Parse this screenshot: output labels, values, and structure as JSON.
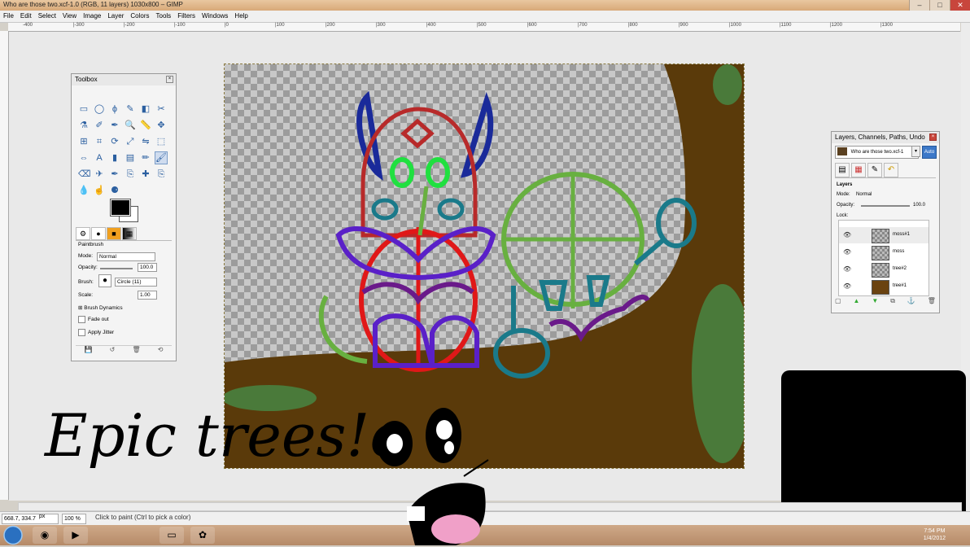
{
  "window": {
    "title": "Who are those two.xcf-1.0 (RGB, 11 layers) 1030x800 – GIMP",
    "controls": [
      "minimize",
      "maximize",
      "close"
    ]
  },
  "menu": [
    "File",
    "Edit",
    "Select",
    "View",
    "Image",
    "Layer",
    "Colors",
    "Tools",
    "Filters",
    "Windows",
    "Help"
  ],
  "ruler": {
    "ticks": [
      "-400",
      "|-300",
      "|-200",
      "|-100",
      "|0",
      "|100",
      "|200",
      "|300",
      "|400",
      "|500",
      "|600",
      "|700",
      "|800",
      "|900",
      "|1000",
      "|1100",
      "|1200",
      "|1300"
    ]
  },
  "toolbox": {
    "title": "Toolbox",
    "tools": [
      "rect-select-icon",
      "ellipse-select-icon",
      "free-select-icon",
      "fuzzy-select-icon",
      "color-select-icon",
      "scissors-icon",
      "foreground-select-icon",
      "paths-icon",
      "color-picker-icon",
      "zoom-icon",
      "measure-icon",
      "move-icon",
      "align-icon",
      "crop-icon",
      "rotate-icon",
      "scale-icon",
      "shear-icon",
      "perspective-icon",
      "flip-icon",
      "text-icon",
      "bucket-fill-icon",
      "blend-icon",
      "pencil-icon",
      "paintbrush-icon",
      "eraser-icon",
      "airbrush-icon",
      "ink-icon",
      "clone-icon",
      "heal-icon",
      "perspective-clone-icon",
      "blur-icon",
      "smudge-icon",
      "dodge-burn-icon"
    ],
    "tool_glyphs": [
      "▭",
      "◯",
      "ϕ",
      "✎",
      "◧",
      "✂",
      "⚗",
      "✐",
      "✒",
      "🔍",
      "📏",
      "✥",
      "⊞",
      "⌗",
      "⟳",
      "⤢",
      "⇋",
      "⬚",
      "⇔",
      "A",
      "▮",
      "▤",
      "✏",
      "🖌",
      "⌫",
      "✈",
      "✒",
      "⎘",
      "✚",
      "⎘",
      "💧",
      "☝",
      "⚈"
    ],
    "options_tab_glyphs": [
      "⚙",
      "●",
      "■",
      "▦"
    ],
    "options": {
      "tool_name": "Paintbrush",
      "mode_label": "Mode:",
      "mode_value": "Normal",
      "opacity_label": "Opacity:",
      "opacity_value": "100.0",
      "brush_label": "Brush:",
      "brush_value": "Circle (11)",
      "scale_label": "Scale:",
      "scale_value": "1.00",
      "brush_dynamics": "Brush Dynamics",
      "fade_out": "Fade out",
      "apply_jitter": "Apply Jitter"
    }
  },
  "layers_dialog": {
    "title": "Layers, Channels, Paths, Undo",
    "image_name": "Who are those two.xcf-1",
    "auto_label": "Auto",
    "section": "Layers",
    "mode_label": "Mode:",
    "mode_value": "Normal",
    "opacity_label": "Opacity:",
    "opacity_value": "100.0",
    "lock_label": "Lock:",
    "layers": [
      {
        "name": "moss#1",
        "selected": true
      },
      {
        "name": "moss",
        "selected": false
      },
      {
        "name": "tree#2",
        "selected": false
      },
      {
        "name": "tree#1",
        "selected": false
      }
    ]
  },
  "statusbar": {
    "coords": "668.7, 334.7",
    "unit": "px",
    "zoom": "100 %",
    "hint": "Click to paint (Ctrl to pick a color)"
  },
  "taskbar": {
    "time": "7:54 PM",
    "date": "1/4/2012"
  },
  "overlay_text": "Epic trees!c",
  "colors": {
    "canvas_brown": "#5a3a0a",
    "moss_green": "#4a7a3a",
    "sketch_blue": "#1a2a9a",
    "sketch_red": "#e01818",
    "sketch_green": "#68b040",
    "sketch_teal": "#1a7a8a",
    "sketch_purple": "#6a1a8a"
  }
}
